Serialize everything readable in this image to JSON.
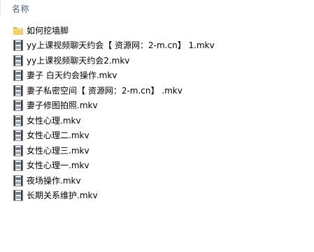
{
  "header": {
    "name_column": "名称"
  },
  "files": [
    {
      "icon": "folder-icon",
      "name": "如何挖墙脚"
    },
    {
      "icon": "video-file-icon",
      "name": "yy上课视频聊天约会【 资源网：2-m.cn】   1.mkv"
    },
    {
      "icon": "video-file-icon",
      "name": "yy上课视频聊天约会2.mkv"
    },
    {
      "icon": "video-file-icon",
      "name": "妻子 白天约会操作.mkv"
    },
    {
      "icon": "video-file-icon",
      "name": "妻子私密空间【 资源网：2-m.cn】    .mkv"
    },
    {
      "icon": "video-file-icon",
      "name": "妻子修图拍照.mkv"
    },
    {
      "icon": "video-file-icon",
      "name": "女性心理.mkv"
    },
    {
      "icon": "video-file-icon",
      "name": "女性心理二.mkv"
    },
    {
      "icon": "video-file-icon",
      "name": "女性心理三.mkv"
    },
    {
      "icon": "video-file-icon",
      "name": "女性心理一.mkv"
    },
    {
      "icon": "video-file-icon",
      "name": "夜场操作.mkv"
    },
    {
      "icon": "video-file-icon",
      "name": "长期关系维护.mkv"
    }
  ],
  "colors": {
    "header_text": "#4c607a",
    "folder": "#e8c157",
    "video_icon_dark": "#3a3a3a"
  }
}
